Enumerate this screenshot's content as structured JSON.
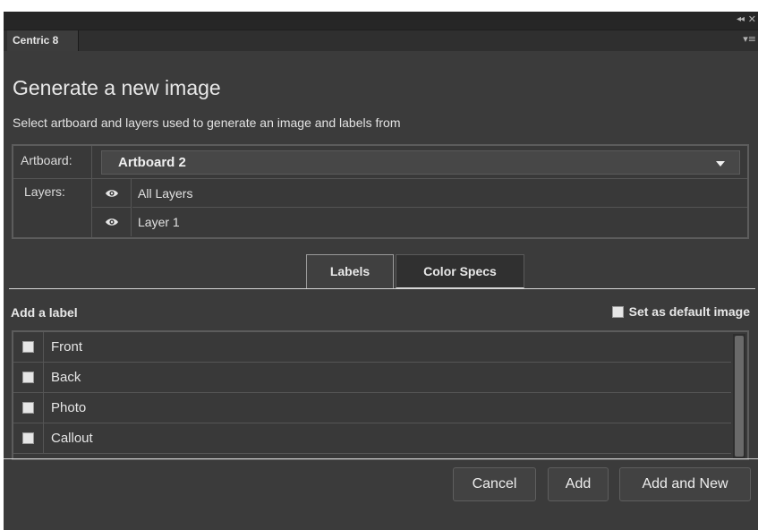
{
  "panel": {
    "tab_name": "Centric 8",
    "collapse_icon": "double-chevron-left-icon",
    "menu_icon": "panel-menu-icon"
  },
  "header": {
    "title": "Generate a new image",
    "subtitle": "Select artboard and layers used to generate an image and labels from"
  },
  "selector": {
    "artboard_label": "Artboard:",
    "artboard_value": "Artboard 2",
    "layers_label": "Layers:",
    "layers": [
      {
        "name": "All Layers",
        "icon": "eye-icon"
      },
      {
        "name": "Layer 1",
        "icon": "eye-icon"
      }
    ]
  },
  "tabs": [
    {
      "label": "Labels",
      "active": true
    },
    {
      "label": "Color Specs",
      "active": false
    }
  ],
  "labels_section": {
    "heading": "Add a label",
    "default_checkbox_label": "Set as default image",
    "items": [
      {
        "label": "Front",
        "checked": false
      },
      {
        "label": "Back",
        "checked": false
      },
      {
        "label": "Photo",
        "checked": false
      },
      {
        "label": "Callout",
        "checked": false
      }
    ]
  },
  "footer": {
    "cancel_label": "Cancel",
    "add_label": "Add",
    "add_new_label": "Add and New"
  },
  "colors": {
    "background": "#3b3b3b",
    "text": "#e8e8e8"
  }
}
